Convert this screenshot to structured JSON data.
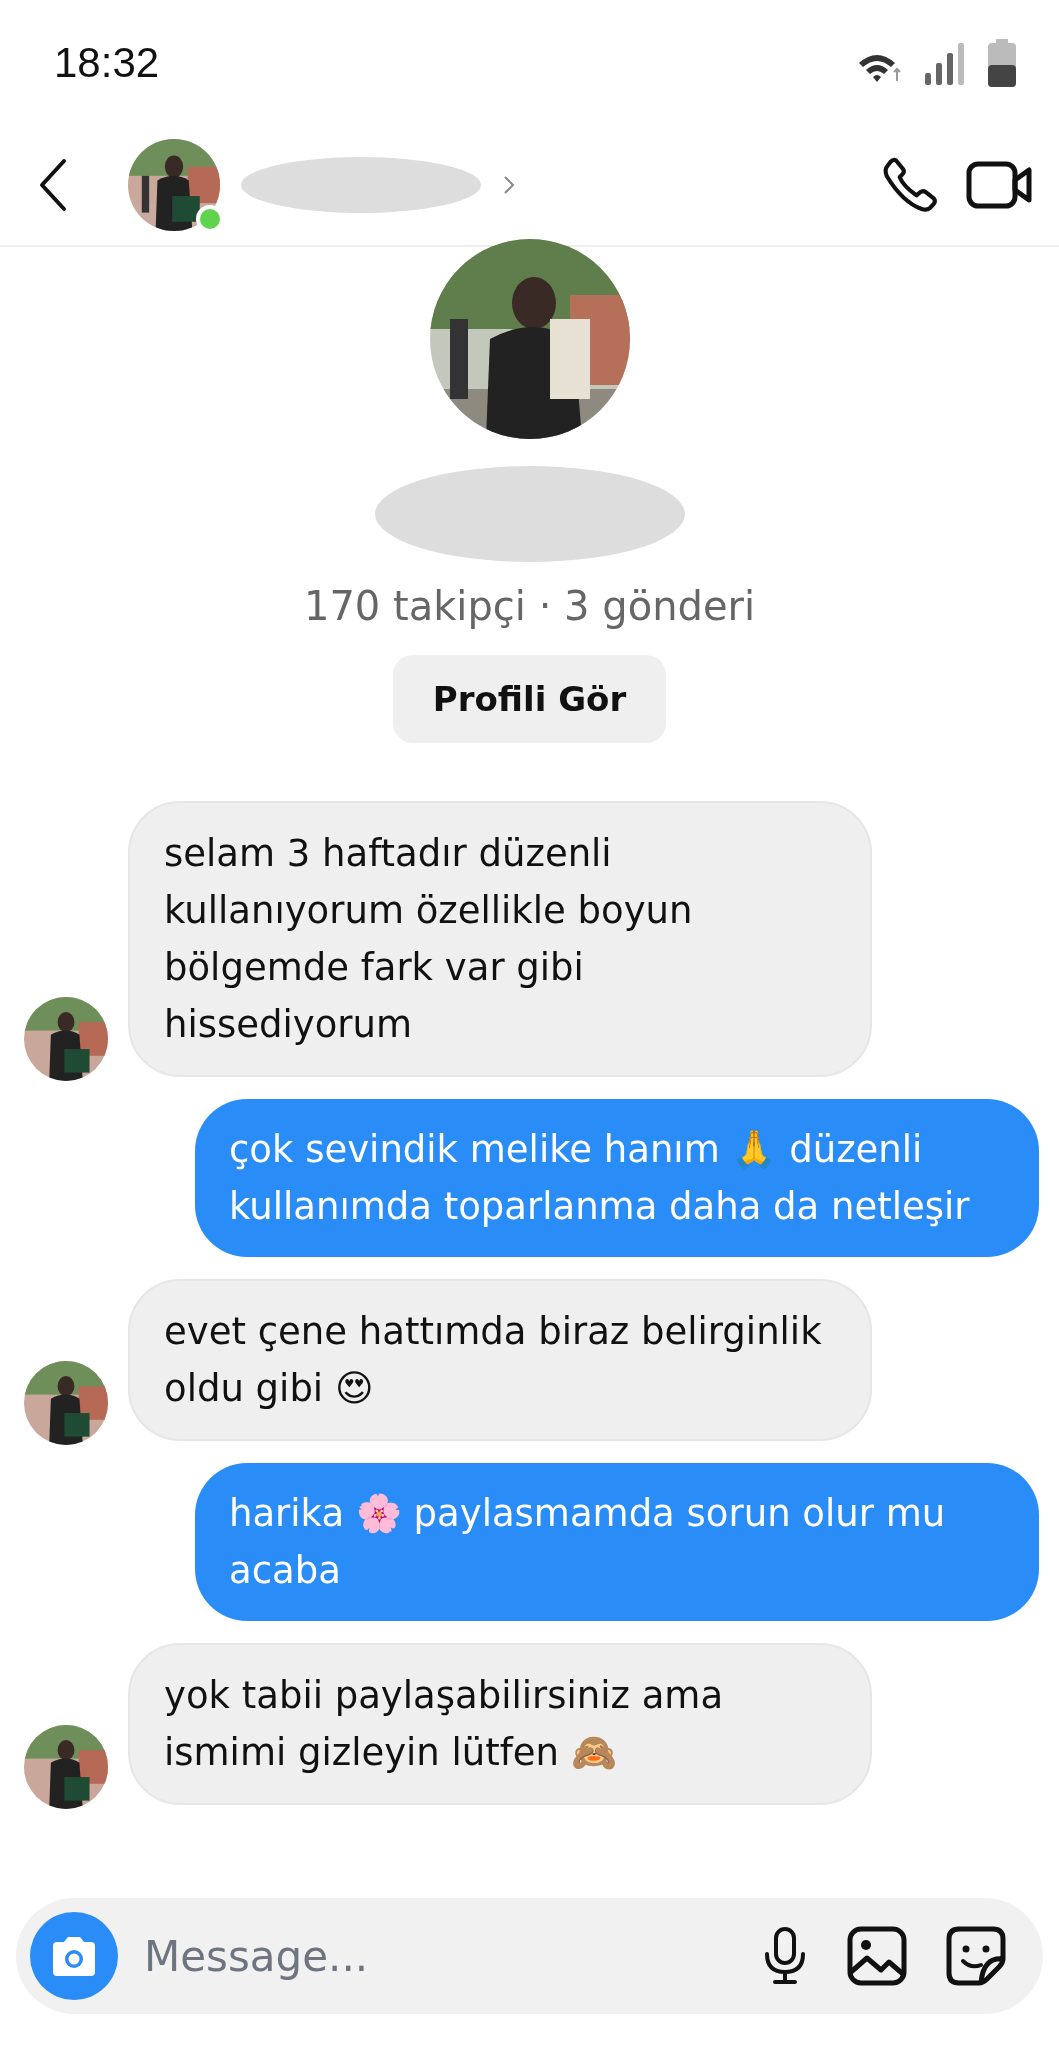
{
  "status_bar": {
    "time": "18:32"
  },
  "header": {
    "online": true
  },
  "profile": {
    "stats": "170 takipçi · 3 gönderi",
    "button": "Profili Gör"
  },
  "messages": [
    {
      "kind": "incoming",
      "text": "selam 3 haftadır düzenli kullanıyorum özellikle boyun bölgemde fark var gibi hissediyorum"
    },
    {
      "kind": "outgoing",
      "text": "çok sevindik melike hanım 🙏 düzenli kullanımda toparlanma daha da netleşir"
    },
    {
      "kind": "incoming",
      "text": "evet çene hattımda biraz belirginlik oldu gibi 😍"
    },
    {
      "kind": "outgoing",
      "text": "harika 🌸 paylasmamda sorun olur mu acaba"
    },
    {
      "kind": "incoming",
      "text": "yok tabii paylaşabilirsiniz ama ismimi gizleyin lütfen 🙈"
    }
  ],
  "composer": {
    "placeholder": "Message..."
  }
}
